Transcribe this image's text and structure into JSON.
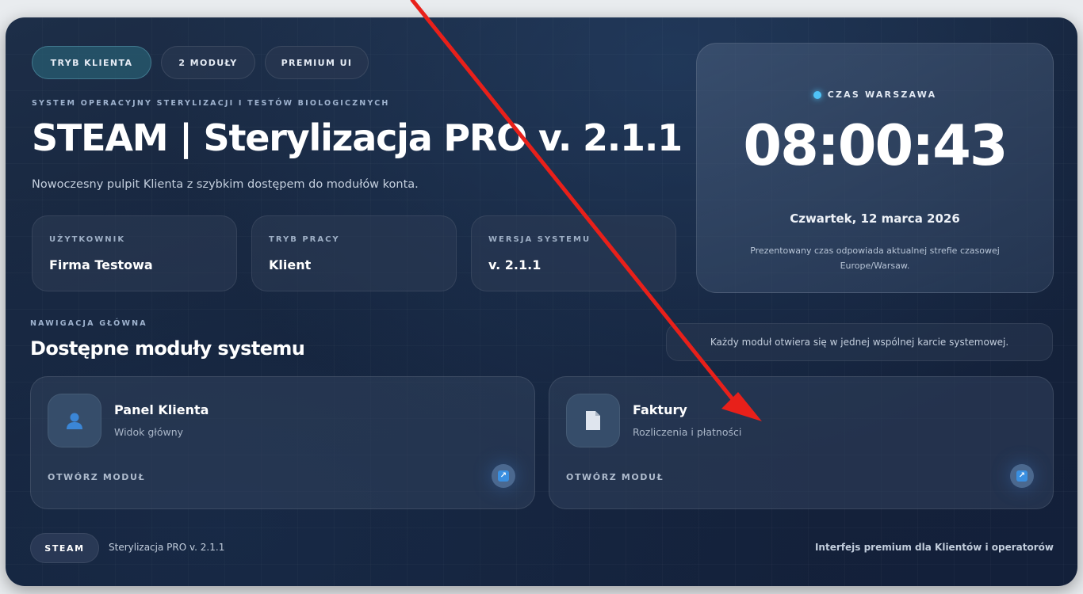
{
  "header": {
    "pills": [
      {
        "label": "TRYB KLIENTA",
        "active": true
      },
      {
        "label": "2 MODUŁY",
        "active": false
      },
      {
        "label": "PREMIUM UI",
        "active": false
      }
    ],
    "eyebrow": "SYSTEM OPERACYJNY STERYLIZACJI I TESTÓW BIOLOGICZNYCH",
    "title": "STEAM | Sterylizacja PRO v. 2.1.1",
    "subtitle": "Nowoczesny pulpit Klienta z szybkim dostępem do modułów konta."
  },
  "info_cards": [
    {
      "label": "UŻYTKOWNIK",
      "value": "Firma Testowa"
    },
    {
      "label": "TRYB PRACY",
      "value": "Klient"
    },
    {
      "label": "WERSJA SYSTEMU",
      "value": "v. 2.1.1"
    }
  ],
  "clock": {
    "zone_label": "CZAS WARSZAWA",
    "time": "08:00:43",
    "date": "Czwartek, 12 marca 2026",
    "note": "Prezentowany czas odpowiada aktualnej strefie czasowej Europe/Warsaw."
  },
  "navigation": {
    "eyebrow": "NAWIGACJA GŁÓWNA",
    "title": "Dostępne moduły systemu",
    "note": "Każdy moduł otwiera się w jednej wspólnej karcie systemowej."
  },
  "modules": [
    {
      "title": "Panel Klienta",
      "subtitle": "Widok główny",
      "open_label": "OTWÓRZ MODUŁ",
      "icon": "user-icon"
    },
    {
      "title": "Faktury",
      "subtitle": "Rozliczenia i płatności",
      "open_label": "OTWÓRZ MODUŁ",
      "icon": "document-icon"
    }
  ],
  "footer": {
    "badge": "STEAM",
    "left_text": "Sterylizacja PRO v. 2.1.1",
    "right_text": "Interfejs premium dla Klientów i operatorów"
  },
  "colors": {
    "accent": "#4fc3f7",
    "annotation_arrow": "#e8201a",
    "background": "#15233b"
  }
}
